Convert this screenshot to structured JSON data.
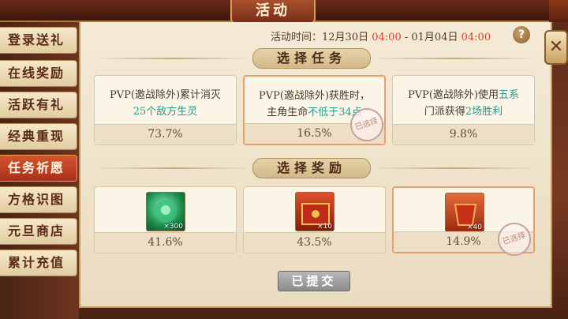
{
  "header": {
    "title": "活动"
  },
  "sidebar": {
    "items": [
      {
        "label": "登录送礼",
        "active": false
      },
      {
        "label": "在线奖励",
        "active": false
      },
      {
        "label": "活跃有礼",
        "active": false
      },
      {
        "label": "经典重现",
        "active": false
      },
      {
        "label": "任务祈愿",
        "active": true
      },
      {
        "label": "方格识图",
        "active": false
      },
      {
        "label": "元旦商店",
        "active": false
      },
      {
        "label": "累计充值",
        "active": false
      }
    ]
  },
  "time": {
    "label": "活动时间：",
    "start_date": "12月30日",
    "start_time": "04:00",
    "separator": " - ",
    "end_date": "01月04日",
    "end_time": "04:00"
  },
  "help_label": "?",
  "close_label": "✕",
  "tasks_section": {
    "title": "选择任务"
  },
  "tasks": [
    {
      "line1": "PVP(邀战除外)累计消灭",
      "highlight": "25个敌方生灵",
      "rest": "",
      "percent": "73.7%",
      "selected": false
    },
    {
      "line1": "PVP(邀战除外)获胜时，",
      "line2a": "主角生命",
      "highlight": "不低于34点",
      "percent": "16.5%",
      "selected": true,
      "stamp": "已选择"
    },
    {
      "line1a": "PVP(邀战除外)使用",
      "highlight1": "五系",
      "line2a": "门派获得",
      "highlight2": "2场胜利",
      "percent": "9.8%",
      "selected": false
    }
  ],
  "rewards_section": {
    "title": "选择奖励"
  },
  "rewards": [
    {
      "icon": "jade-icon",
      "qty": "×300",
      "percent": "41.6%",
      "selected": false
    },
    {
      "icon": "treasure-chest-icon",
      "qty": "×10",
      "percent": "43.5%",
      "selected": false
    },
    {
      "icon": "red-pouch-icon",
      "qty": "×40",
      "percent": "14.9%",
      "selected": true,
      "stamp": "已选择"
    }
  ],
  "submit": {
    "label": "已提交"
  },
  "colors": {
    "accent": "#d8402a",
    "highlight": "#2a9a8a",
    "active_tab": "#c0482a"
  }
}
